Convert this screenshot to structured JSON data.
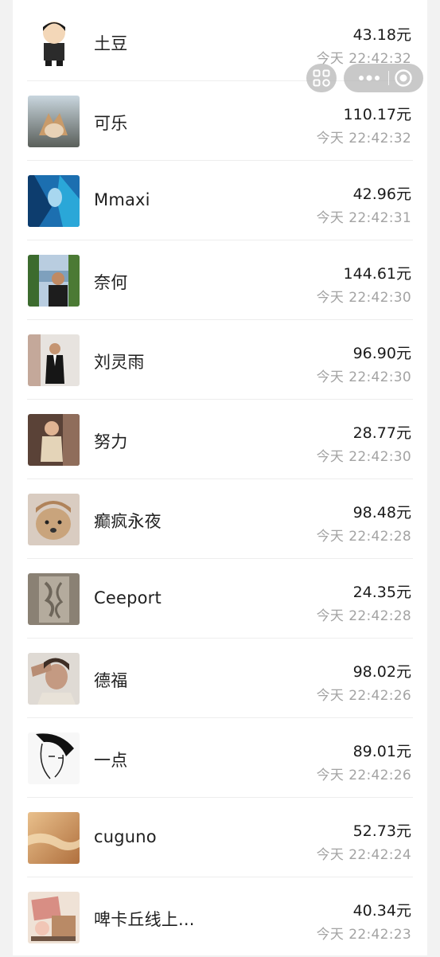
{
  "list": [
    {
      "name": "土豆",
      "amount": "43.18元",
      "day": "今天",
      "time": "22:42:32",
      "avatar": "cartoon-boy-avatar"
    },
    {
      "name": "可乐",
      "amount": "110.17元",
      "day": "今天",
      "time": "22:42:32",
      "avatar": "dog-photo-avatar"
    },
    {
      "name": "Mmaxi",
      "amount": "42.96元",
      "day": "今天",
      "time": "22:42:31",
      "avatar": "anime-character-avatar"
    },
    {
      "name": "奈何",
      "amount": "144.61元",
      "day": "今天",
      "time": "22:42:30",
      "avatar": "man-lakeside-avatar"
    },
    {
      "name": "刘灵雨",
      "amount": "96.90元",
      "day": "今天",
      "time": "22:42:30",
      "avatar": "man-suit-avatar"
    },
    {
      "name": "努力",
      "amount": "28.77元",
      "day": "今天",
      "time": "22:42:30",
      "avatar": "child-photo-avatar"
    },
    {
      "name": "癫疯永夜",
      "amount": "98.48元",
      "day": "今天",
      "time": "22:42:28",
      "avatar": "dog-hat-avatar"
    },
    {
      "name": "Ceeport",
      "amount": "24.35元",
      "day": "今天",
      "time": "22:42:28",
      "avatar": "carved-stone-avatar"
    },
    {
      "name": "德福",
      "amount": "98.02元",
      "day": "今天",
      "time": "22:42:26",
      "avatar": "woman-portrait-avatar"
    },
    {
      "name": "一点",
      "amount": "89.01元",
      "day": "今天",
      "time": "22:42:26",
      "avatar": "sketch-portrait-avatar"
    },
    {
      "name": "cuguno",
      "amount": "52.73元",
      "day": "今天",
      "time": "22:42:24",
      "avatar": "sunset-water-avatar"
    },
    {
      "name": "啤卡丘线上...",
      "amount": "40.34元",
      "day": "今天",
      "time": "22:42:23",
      "avatar": "illustration-avatar"
    }
  ],
  "capsule": {
    "more_icon": "more-dots-icon",
    "close_icon": "close-circle-icon",
    "float_icon": "grid-squares-icon"
  },
  "colors": {
    "background": "#f2f2f2",
    "card": "#ffffff",
    "amount": "#1b1b1b",
    "time": "#a3a3a3"
  }
}
